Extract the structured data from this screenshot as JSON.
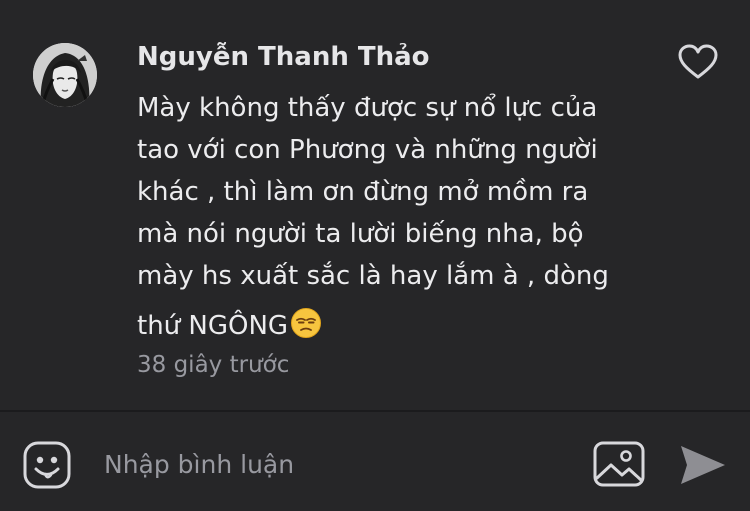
{
  "comment": {
    "author": "Nguyễn Thanh Thảo",
    "lines": [
      "Mày không thấy được sự nổ lực của",
      "tao với con Phương và những người",
      "khác , thì làm ơn đừng mở mồm ra",
      "mà nói người ta lười biếng nha, bộ",
      "mày hs xuất sắc là hay lắm à , dòng",
      "thứ NGÔNG"
    ],
    "trailing_emoji": "unamused-face",
    "timestamp": "38 giây trước",
    "like_icon": "heart-outline-icon"
  },
  "input_bar": {
    "placeholder": "Nhập bình luận",
    "value": "",
    "emoji_icon": "smiley-face-icon",
    "image_icon": "image-icon",
    "send_icon": "send-icon"
  },
  "colors": {
    "background": "#262628",
    "text_primary": "#ececee",
    "text_secondary": "#9899a0",
    "icon": "#d8d8dc",
    "send_icon": "#8e8e93"
  }
}
